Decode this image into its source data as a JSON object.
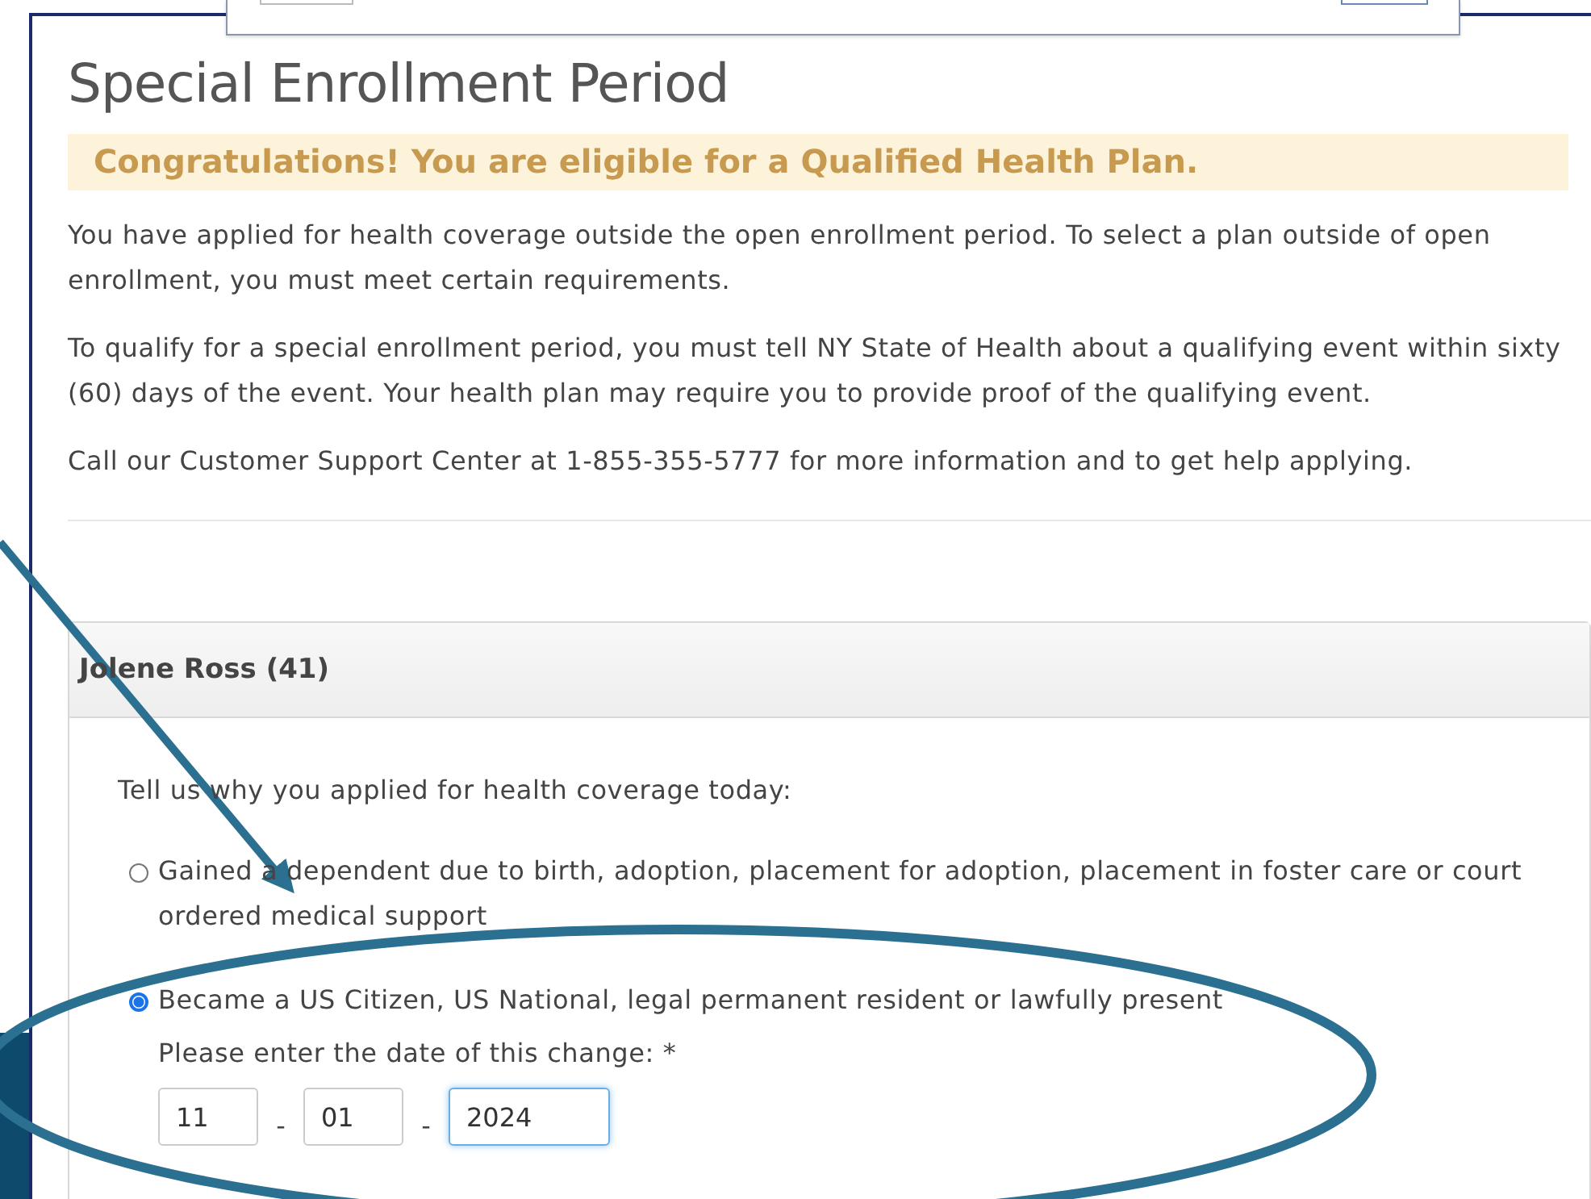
{
  "page": {
    "title": "Special Enrollment Period"
  },
  "banner": "Congratulations! You are eligible for a Qualified Health Plan.",
  "paragraphs": [
    "You have applied for health coverage outside the open enrollment period. To select a plan outside of open enrollment, you must meet certain requirements.",
    "To qualify for a special enrollment period, you must tell NY State of Health about a qualifying event within sixty (60) days of the event. Your health plan may require you to provide proof of the qualifying event.",
    "Call our Customer Support Center at 1-855-355-5777 for more information and to get help applying."
  ],
  "card": {
    "header": "Jolene Ross (41)",
    "question": "Tell us why you applied for health coverage today:",
    "options": [
      {
        "label": "Gained a dependent due to birth, adoption, placement for adoption, placement in foster care or court ordered medical support",
        "selected": false
      },
      {
        "label": "Became a US Citizen, US National, legal permanent resident or lawfully present",
        "selected": true,
        "date_label": "Please enter the date of this change: *",
        "separator": "-",
        "date_fields": [
          {
            "value": "11",
            "focused": false
          },
          {
            "value": "01",
            "focused": false
          },
          {
            "value": "2024",
            "focused": true
          }
        ]
      }
    ]
  }
}
